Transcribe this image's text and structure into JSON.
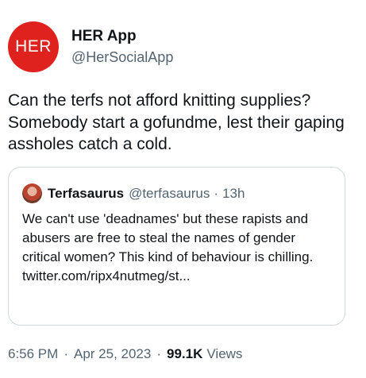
{
  "author": {
    "avatar_text": "HER",
    "display_name": "HER App",
    "handle": "@HerSocialApp",
    "avatar_color": "#e0221f"
  },
  "tweet": {
    "text": "Can the terfs not afford knitting supplies? Somebody start a gofundme, lest their gaping assholes catch a cold."
  },
  "quoted": {
    "display_name": "Terfasaurus",
    "handle": "@terfasaurus",
    "separator": "·",
    "time": "13h",
    "text": "We can't use 'deadnames' but these rapists and abusers are free to steal the names of gender critical women? This kind of behaviour is chilling.",
    "link": "twitter.com/ripx4nutmeg/st..."
  },
  "meta": {
    "time": "6:56 PM",
    "separator": "·",
    "date": "Apr 25, 2023",
    "views_count": "99.1K",
    "views_label": "Views"
  }
}
